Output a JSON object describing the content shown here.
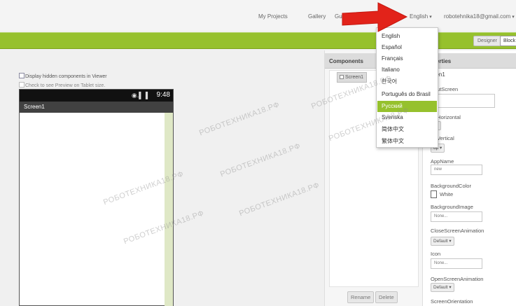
{
  "header": {
    "nav": [
      "My Projects",
      "Gallery",
      "Gu"
    ],
    "language": "English",
    "account": "robotehnika18@gmail.com"
  },
  "toolbar": {
    "designer_label": "Designer",
    "blocks_label": "Block"
  },
  "viewer": {
    "display_hidden_label": "Display hidden components in Viewer",
    "tablet_preview_label": "Check to see Preview on Tablet size.",
    "status_time": "9:48",
    "status_icons": "◉.▌▐",
    "screen_title": "Screen1"
  },
  "components": {
    "heading": "Components",
    "screen_node": "Screen1",
    "rename_label": "Rename",
    "delete_label": "Delete"
  },
  "properties": {
    "heading": "perties",
    "screen_name": "een1",
    "about_screen_label": "outScreen",
    "align_horizontal_label": "nHorizontal",
    "align_horizontal_value": "t",
    "align_vertical_label": "nVertical",
    "align_vertical_value": "op",
    "app_name_label": "AppName",
    "app_name_value": "new",
    "background_color_label": "BackgroundColor",
    "background_color_value": "White",
    "background_image_label": "BackgroundImage",
    "background_image_value": "None...",
    "close_anim_label": "CloseScreenAnimation",
    "close_anim_value": "Default",
    "icon_label": "Icon",
    "icon_value": "None...",
    "open_anim_label": "OpenScreenAnimation",
    "open_anim_value": "Default",
    "orientation_label": "ScreenOrientation"
  },
  "language_menu": {
    "items": [
      "English",
      "Español",
      "Français",
      "Italiano",
      "한국어",
      "Português do Brasil",
      "Русский",
      "Svenska",
      "简体中文",
      "繁体中文"
    ],
    "selected": "Русский"
  },
  "watermark": "РОБОТЕХНИКА18.РФ",
  "colors": {
    "brand_green": "#96c12d",
    "arrow_red": "#e2231a"
  }
}
